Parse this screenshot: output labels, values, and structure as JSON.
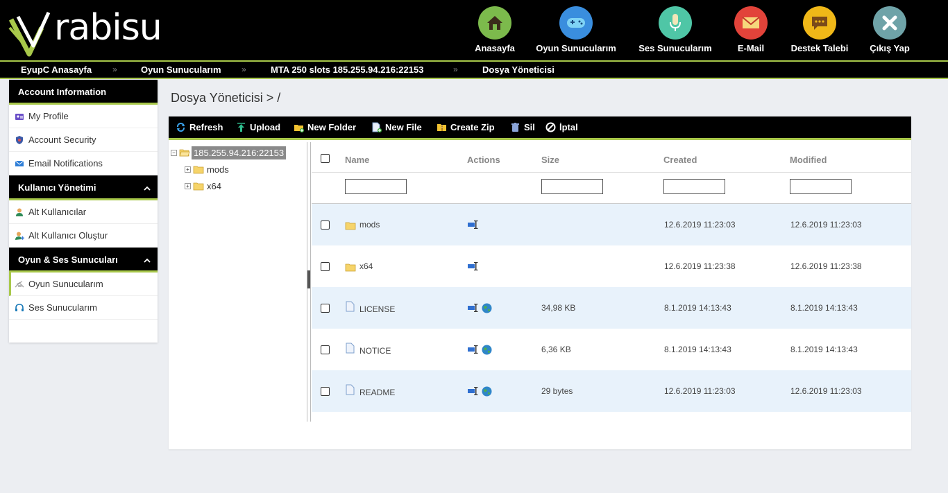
{
  "brand": {
    "logo_text": "rabisu"
  },
  "colors": {
    "accent": "#a8c84a",
    "header_bg": "#000000",
    "row_alt": "#e8f2fb"
  },
  "nav": [
    {
      "label": "Anasayfa",
      "icon": "home-icon",
      "color": "#7cba4c"
    },
    {
      "label": "Oyun Sunucularım",
      "icon": "gamepad-icon",
      "color": "#3a8ede"
    },
    {
      "label": "Ses Sunucularım",
      "icon": "microphone-icon",
      "color": "#4fc6a6"
    },
    {
      "label": "E-Mail",
      "icon": "envelope-icon",
      "color": "#e2433a"
    },
    {
      "label": "Destek Talebi",
      "icon": "chat-bubble-icon",
      "color": "#f0b818"
    },
    {
      "label": "Çıkış Yap",
      "icon": "close-icon",
      "color": "#6fa3a8"
    }
  ],
  "breadcrumb": [
    "EyupC Anasayfa",
    "Oyun Sunucularım",
    "MTA 250 slots 185.255.94.216:22153",
    "Dosya Yöneticisi"
  ],
  "breadcrumb_sep": "»",
  "sidebar": {
    "sections": [
      {
        "title": "Account Information",
        "collapsible": false,
        "items": [
          {
            "label": "My Profile",
            "icon": "id-card-icon"
          },
          {
            "label": "Account Security",
            "icon": "shield-icon"
          },
          {
            "label": "Email Notifications",
            "icon": "envelope-icon"
          }
        ]
      },
      {
        "title": "Kullanıcı Yönetimi",
        "collapsible": true,
        "items": [
          {
            "label": "Alt Kullanıcılar",
            "icon": "user-icon"
          },
          {
            "label": "Alt Kullanıcı Oluştur",
            "icon": "user-add-icon"
          }
        ]
      },
      {
        "title": "Oyun & Ses Sunucuları",
        "collapsible": true,
        "items": [
          {
            "label": "Oyun Sunucularım",
            "icon": "game-server-icon",
            "active": true
          },
          {
            "label": "Ses Sunucularım",
            "icon": "headset-icon"
          }
        ]
      }
    ],
    "chevron": "^"
  },
  "page_title": "Dosya Yöneticisi > /",
  "toolbar": [
    "Refresh",
    "Upload",
    "New Folder",
    "New File",
    "Create Zip",
    "Sil",
    "İptal"
  ],
  "tree": {
    "root": "185.255.94.216:22153",
    "children": [
      "mods",
      "x64"
    ]
  },
  "grid": {
    "columns": {
      "name": "Name",
      "actions": "Actions",
      "size": "Size",
      "created": "Created",
      "modified": "Modified"
    },
    "filters": {
      "name": "",
      "size": "",
      "created": "",
      "modified": ""
    },
    "rows": [
      {
        "name": "mods",
        "type": "folder",
        "size": "",
        "created": "12.6.2019 11:23:03",
        "modified": "12.6.2019 11:23:03"
      },
      {
        "name": "x64",
        "type": "folder",
        "size": "",
        "created": "12.6.2019 11:23:38",
        "modified": "12.6.2019 11:23:38"
      },
      {
        "name": "LICENSE",
        "type": "file",
        "size": "34,98 KB",
        "created": "8.1.2019 14:13:43",
        "modified": "8.1.2019 14:13:43"
      },
      {
        "name": "NOTICE",
        "type": "file",
        "size": "6,36 KB",
        "created": "8.1.2019 14:13:43",
        "modified": "8.1.2019 14:13:43"
      },
      {
        "name": "README",
        "type": "file",
        "size": "29 bytes",
        "created": "12.6.2019 11:23:03",
        "modified": "12.6.2019 11:23:03"
      }
    ]
  }
}
